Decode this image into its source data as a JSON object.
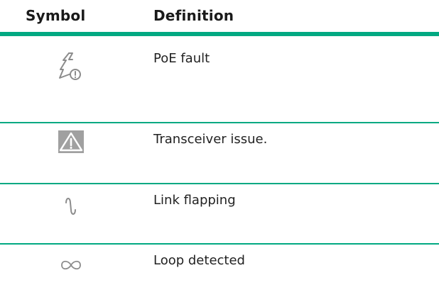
{
  "header": {
    "symbol": "Symbol",
    "definition": "Definition"
  },
  "rows": [
    {
      "icon": "poe-fault-icon",
      "definition": "PoE fault"
    },
    {
      "icon": "warning-triangle-icon",
      "definition": "Transceiver issue."
    },
    {
      "icon": "link-flapping-icon",
      "definition": "Link flapping"
    },
    {
      "icon": "loop-infinity-icon",
      "definition": "Loop detected"
    }
  ],
  "colors": {
    "rule": "#01a982",
    "icon_gray": "#8c8c8c",
    "warning_bg": "#a0a0a0"
  }
}
